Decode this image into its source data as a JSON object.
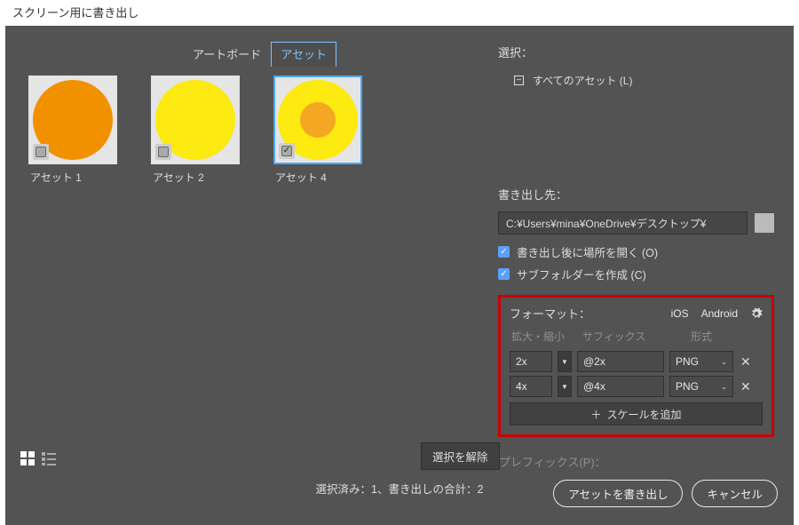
{
  "window": {
    "title": "スクリーン用に書き出し"
  },
  "tabs": {
    "artboards": "アートボード",
    "assets": "アセット"
  },
  "assets": [
    {
      "label": "アセット 1",
      "checked": false,
      "selected": false,
      "shape": "orange"
    },
    {
      "label": "アセット 2",
      "checked": false,
      "selected": false,
      "shape": "yellow"
    },
    {
      "label": "アセット 4",
      "checked": true,
      "selected": true,
      "shape": "target"
    }
  ],
  "selection": {
    "label": "選択：",
    "all": "すべてのアセット (L)"
  },
  "destination": {
    "label": "書き出し先：",
    "path": "C:¥Users¥mina¥OneDrive¥デスクトップ¥",
    "open_after": "書き出し後に場所を開く (O)",
    "create_sub": "サブフォルダーを作成 (C)"
  },
  "format": {
    "label": "フォーマット：",
    "tab_ios": "iOS",
    "tab_android": "Android",
    "col_scale": "拡大・縮小",
    "col_suffix": "サフィックス",
    "col_format": "形式",
    "rows": [
      {
        "scale": "2x",
        "suffix": "@2x",
        "fmt": "PNG"
      },
      {
        "scale": "4x",
        "suffix": "@4x",
        "fmt": "PNG"
      }
    ],
    "add_scale": "スケールを追加"
  },
  "bottom": {
    "deselect": "選択を解除",
    "prefix_label": "プレフィックス(P)：",
    "status": "選択済み：1、書き出しの合計：2",
    "export": "アセットを書き出し",
    "cancel": "キャンセル"
  }
}
